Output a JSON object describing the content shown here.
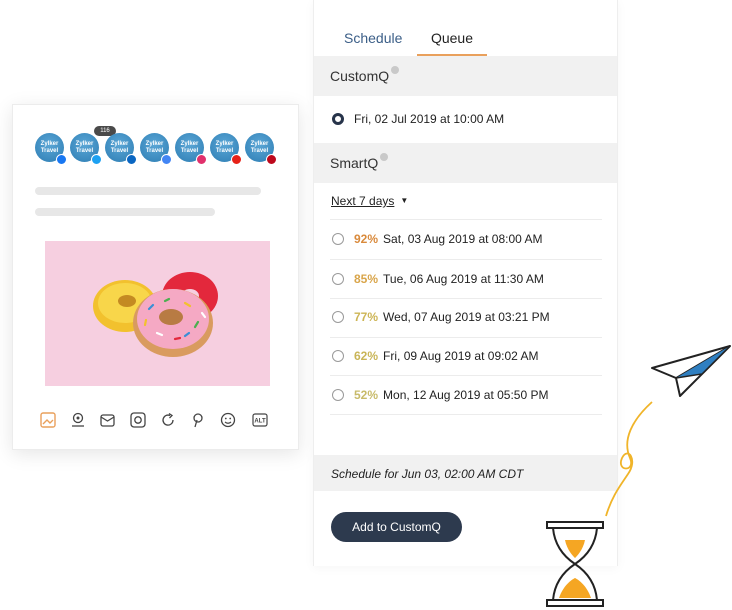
{
  "composer": {
    "avatar_label": "Zylker Travel",
    "badge_count": "116",
    "networks": [
      {
        "name": "facebook",
        "color": "#1877f2"
      },
      {
        "name": "twitter",
        "color": "#1da1f2"
      },
      {
        "name": "linkedin",
        "color": "#0a66c2"
      },
      {
        "name": "google-my-business",
        "color": "#4285f4"
      },
      {
        "name": "instagram",
        "color": "#e1306c"
      },
      {
        "name": "youtube",
        "color": "#e62117"
      },
      {
        "name": "pinterest",
        "color": "#bd081c"
      }
    ],
    "toolbar_icons": [
      "image-icon",
      "location-icon",
      "mention-icon",
      "link-icon",
      "refresh-icon",
      "pinterest-icon",
      "emoji-icon",
      "alt-text-icon"
    ],
    "alt_label": "ALT",
    "accent": "#e9a05c"
  },
  "tabs": [
    {
      "label": "Schedule",
      "active": false
    },
    {
      "label": "Queue",
      "active": true
    }
  ],
  "customq": {
    "title": "CustomQ",
    "slots": [
      {
        "label": "Fri, 02 Jul 2019 at 10:00 AM",
        "selected": true
      }
    ]
  },
  "smartq": {
    "title": "SmartQ",
    "range": "Next 7 days",
    "slots": [
      {
        "pct": "92%",
        "label": "Sat, 03 Aug 2019 at 08:00 AM",
        "color": "#d98a3c"
      },
      {
        "pct": "85%",
        "label": "Tue, 06 Aug 2019 at 11:30 AM",
        "color": "#d9a54a"
      },
      {
        "pct": "77%",
        "label": "Wed, 07 Aug 2019 at 03:21 PM",
        "color": "#cdb555"
      },
      {
        "pct": "62%",
        "label": "Fri, 09 Aug 2019 at 09:02 AM",
        "color": "#c9b557"
      },
      {
        "pct": "52%",
        "label": "Mon, 12 Aug 2019 at 05:50 PM",
        "color": "#c8bb6a"
      }
    ]
  },
  "schedule_for": "Schedule for Jun 03, 02:00 AM  CDT",
  "add_button": "Add to CustomQ",
  "colors": {
    "tab_active": "#3b5e87",
    "button": "#2d3a4e",
    "section_bg": "#f1f1f1"
  }
}
